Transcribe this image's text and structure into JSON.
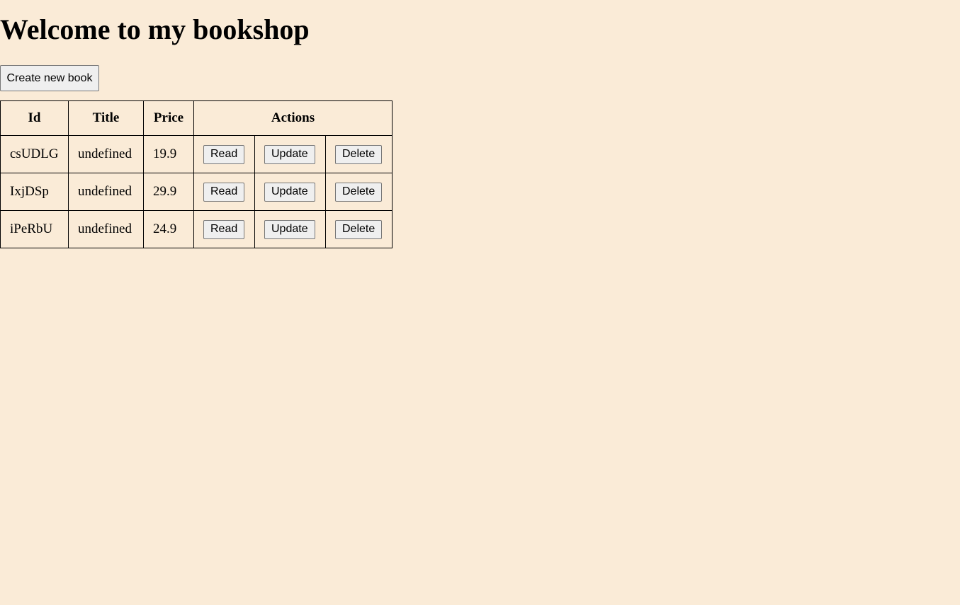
{
  "page": {
    "heading": "Welcome to my bookshop",
    "create_button_label": "Create new book",
    "background_color": "#faebd7"
  },
  "table": {
    "headers": {
      "id": "Id",
      "title": "Title",
      "price": "Price",
      "actions": "Actions"
    },
    "rows": [
      {
        "id": "csUDLG",
        "title": "undefined",
        "price": "19.9"
      },
      {
        "id": "IxjDSp",
        "title": "undefined",
        "price": "29.9"
      },
      {
        "id": "iPeRbU",
        "title": "undefined",
        "price": "24.9"
      }
    ],
    "action_labels": {
      "read": "Read",
      "update": "Update",
      "delete": "Delete"
    }
  }
}
